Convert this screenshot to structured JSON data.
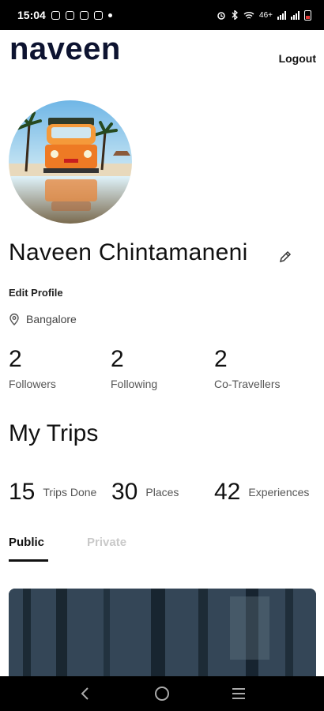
{
  "status_bar": {
    "time": "15:04",
    "network": "46+",
    "battery_color": "#e53935"
  },
  "header": {
    "username": "naveen",
    "logout_label": "Logout"
  },
  "profile": {
    "full_name": "Naveen Chintamaneni",
    "edit_profile_label": "Edit Profile",
    "location": "Bangalore",
    "avatar_icon": "photo-van-beach"
  },
  "social_stats": [
    {
      "value": "2",
      "label": "Followers"
    },
    {
      "value": "2",
      "label": "Following"
    },
    {
      "value": "2",
      "label": "Co-Travellers"
    }
  ],
  "trips": {
    "title": "My Trips",
    "stats": [
      {
        "value": "15",
        "label": "Trips Done"
      },
      {
        "value": "30",
        "label": "Places"
      },
      {
        "value": "42",
        "label": "Experiences"
      }
    ],
    "tabs": [
      {
        "label": "Public",
        "active": true
      },
      {
        "label": "Private",
        "active": false
      }
    ]
  },
  "colors": {
    "accent_dark": "#0d1330",
    "inactive_tab": "#c9c9c9"
  }
}
